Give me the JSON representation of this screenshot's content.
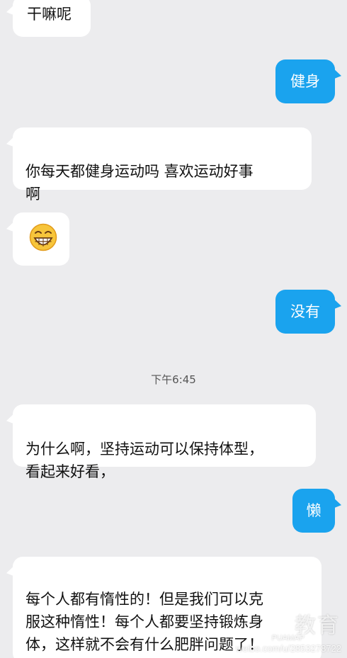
{
  "messages": [
    {
      "side": "in",
      "text": "干嘛呢"
    },
    {
      "side": "out",
      "text": "健身"
    },
    {
      "side": "in",
      "text": "你每天都健身运动吗   喜欢运动好事\n啊"
    },
    {
      "side": "in",
      "emoji": "grinning-face"
    },
    {
      "side": "out",
      "text": "没有"
    },
    {
      "side": "in",
      "text": "为什么啊，坚持运动可以保持体型，\n看起来好看，"
    },
    {
      "side": "out",
      "text": "懒"
    },
    {
      "side": "in",
      "text": "每个人都有惰性的！但是我们可以克\n服这种惰性！每个人都要坚持锻炼身\n体，这样就不会有什么肥胖问题了！\n加油！我相信你的！"
    }
  ],
  "timestamp": "下午6:45",
  "watermark": {
    "logo": "教育",
    "sub": "PUAMAP",
    "url": "weibo.com/u/2853278722"
  },
  "colors": {
    "background": "#ececee",
    "incoming_bubble": "#ffffff",
    "outgoing_bubble": "#1aa3ee"
  }
}
